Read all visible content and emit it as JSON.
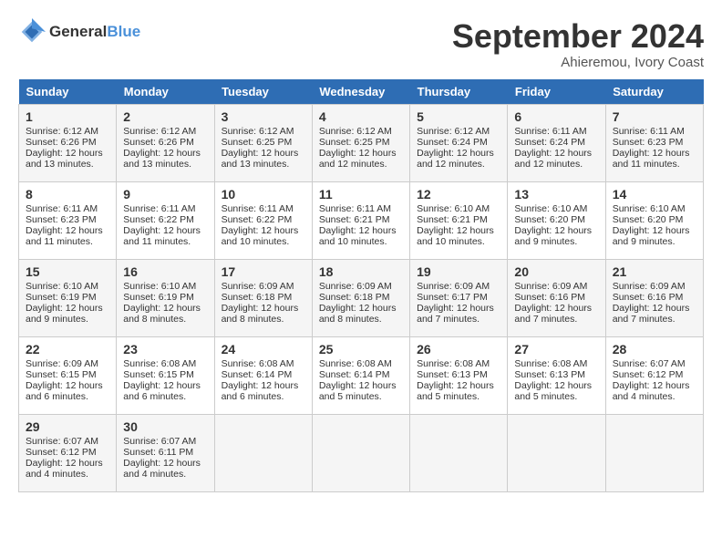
{
  "header": {
    "logo_line1": "General",
    "logo_line2": "Blue",
    "month": "September 2024",
    "location": "Ahieremou, Ivory Coast"
  },
  "days_of_week": [
    "Sunday",
    "Monday",
    "Tuesday",
    "Wednesday",
    "Thursday",
    "Friday",
    "Saturday"
  ],
  "weeks": [
    [
      {
        "day": "1",
        "lines": [
          "Sunrise: 6:12 AM",
          "Sunset: 6:26 PM",
          "Daylight: 12 hours",
          "and 13 minutes."
        ]
      },
      {
        "day": "2",
        "lines": [
          "Sunrise: 6:12 AM",
          "Sunset: 6:26 PM",
          "Daylight: 12 hours",
          "and 13 minutes."
        ]
      },
      {
        "day": "3",
        "lines": [
          "Sunrise: 6:12 AM",
          "Sunset: 6:25 PM",
          "Daylight: 12 hours",
          "and 13 minutes."
        ]
      },
      {
        "day": "4",
        "lines": [
          "Sunrise: 6:12 AM",
          "Sunset: 6:25 PM",
          "Daylight: 12 hours",
          "and 12 minutes."
        ]
      },
      {
        "day": "5",
        "lines": [
          "Sunrise: 6:12 AM",
          "Sunset: 6:24 PM",
          "Daylight: 12 hours",
          "and 12 minutes."
        ]
      },
      {
        "day": "6",
        "lines": [
          "Sunrise: 6:11 AM",
          "Sunset: 6:24 PM",
          "Daylight: 12 hours",
          "and 12 minutes."
        ]
      },
      {
        "day": "7",
        "lines": [
          "Sunrise: 6:11 AM",
          "Sunset: 6:23 PM",
          "Daylight: 12 hours",
          "and 11 minutes."
        ]
      }
    ],
    [
      {
        "day": "8",
        "lines": [
          "Sunrise: 6:11 AM",
          "Sunset: 6:23 PM",
          "Daylight: 12 hours",
          "and 11 minutes."
        ]
      },
      {
        "day": "9",
        "lines": [
          "Sunrise: 6:11 AM",
          "Sunset: 6:22 PM",
          "Daylight: 12 hours",
          "and 11 minutes."
        ]
      },
      {
        "day": "10",
        "lines": [
          "Sunrise: 6:11 AM",
          "Sunset: 6:22 PM",
          "Daylight: 12 hours",
          "and 10 minutes."
        ]
      },
      {
        "day": "11",
        "lines": [
          "Sunrise: 6:11 AM",
          "Sunset: 6:21 PM",
          "Daylight: 12 hours",
          "and 10 minutes."
        ]
      },
      {
        "day": "12",
        "lines": [
          "Sunrise: 6:10 AM",
          "Sunset: 6:21 PM",
          "Daylight: 12 hours",
          "and 10 minutes."
        ]
      },
      {
        "day": "13",
        "lines": [
          "Sunrise: 6:10 AM",
          "Sunset: 6:20 PM",
          "Daylight: 12 hours",
          "and 9 minutes."
        ]
      },
      {
        "day": "14",
        "lines": [
          "Sunrise: 6:10 AM",
          "Sunset: 6:20 PM",
          "Daylight: 12 hours",
          "and 9 minutes."
        ]
      }
    ],
    [
      {
        "day": "15",
        "lines": [
          "Sunrise: 6:10 AM",
          "Sunset: 6:19 PM",
          "Daylight: 12 hours",
          "and 9 minutes."
        ]
      },
      {
        "day": "16",
        "lines": [
          "Sunrise: 6:10 AM",
          "Sunset: 6:19 PM",
          "Daylight: 12 hours",
          "and 8 minutes."
        ]
      },
      {
        "day": "17",
        "lines": [
          "Sunrise: 6:09 AM",
          "Sunset: 6:18 PM",
          "Daylight: 12 hours",
          "and 8 minutes."
        ]
      },
      {
        "day": "18",
        "lines": [
          "Sunrise: 6:09 AM",
          "Sunset: 6:18 PM",
          "Daylight: 12 hours",
          "and 8 minutes."
        ]
      },
      {
        "day": "19",
        "lines": [
          "Sunrise: 6:09 AM",
          "Sunset: 6:17 PM",
          "Daylight: 12 hours",
          "and 7 minutes."
        ]
      },
      {
        "day": "20",
        "lines": [
          "Sunrise: 6:09 AM",
          "Sunset: 6:16 PM",
          "Daylight: 12 hours",
          "and 7 minutes."
        ]
      },
      {
        "day": "21",
        "lines": [
          "Sunrise: 6:09 AM",
          "Sunset: 6:16 PM",
          "Daylight: 12 hours",
          "and 7 minutes."
        ]
      }
    ],
    [
      {
        "day": "22",
        "lines": [
          "Sunrise: 6:09 AM",
          "Sunset: 6:15 PM",
          "Daylight: 12 hours",
          "and 6 minutes."
        ]
      },
      {
        "day": "23",
        "lines": [
          "Sunrise: 6:08 AM",
          "Sunset: 6:15 PM",
          "Daylight: 12 hours",
          "and 6 minutes."
        ]
      },
      {
        "day": "24",
        "lines": [
          "Sunrise: 6:08 AM",
          "Sunset: 6:14 PM",
          "Daylight: 12 hours",
          "and 6 minutes."
        ]
      },
      {
        "day": "25",
        "lines": [
          "Sunrise: 6:08 AM",
          "Sunset: 6:14 PM",
          "Daylight: 12 hours",
          "and 5 minutes."
        ]
      },
      {
        "day": "26",
        "lines": [
          "Sunrise: 6:08 AM",
          "Sunset: 6:13 PM",
          "Daylight: 12 hours",
          "and 5 minutes."
        ]
      },
      {
        "day": "27",
        "lines": [
          "Sunrise: 6:08 AM",
          "Sunset: 6:13 PM",
          "Daylight: 12 hours",
          "and 5 minutes."
        ]
      },
      {
        "day": "28",
        "lines": [
          "Sunrise: 6:07 AM",
          "Sunset: 6:12 PM",
          "Daylight: 12 hours",
          "and 4 minutes."
        ]
      }
    ],
    [
      {
        "day": "29",
        "lines": [
          "Sunrise: 6:07 AM",
          "Sunset: 6:12 PM",
          "Daylight: 12 hours",
          "and 4 minutes."
        ]
      },
      {
        "day": "30",
        "lines": [
          "Sunrise: 6:07 AM",
          "Sunset: 6:11 PM",
          "Daylight: 12 hours",
          "and 4 minutes."
        ]
      },
      {
        "day": "",
        "lines": []
      },
      {
        "day": "",
        "lines": []
      },
      {
        "day": "",
        "lines": []
      },
      {
        "day": "",
        "lines": []
      },
      {
        "day": "",
        "lines": []
      }
    ]
  ]
}
